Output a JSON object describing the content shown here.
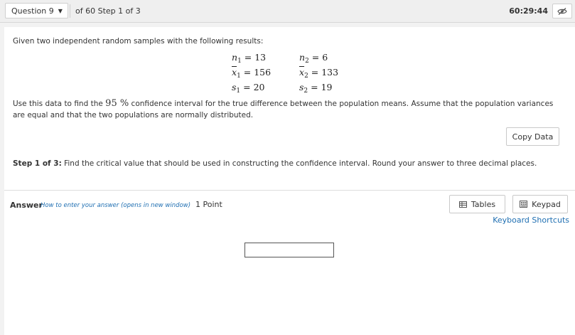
{
  "header": {
    "question_selector": "Question 9",
    "of_steps": "of 60 Step 1 of 3",
    "timer": "60:29:44",
    "visibility_icon": "eye-slash-icon"
  },
  "problem": {
    "intro": "Given two independent random samples with the following results:",
    "sample_stats": {
      "n1": "13",
      "n2": "6",
      "xbar1": "156",
      "xbar2": "133",
      "s1": "20",
      "s2": "19"
    },
    "paragraph_before": "Use this data to find the ",
    "confidence_level": "95 %",
    "paragraph_after": " confidence interval for the true difference between the population means. Assume that the population variances are equal and that the two populations are normally distributed.",
    "copy_button": "Copy Data"
  },
  "step": {
    "label": "Step 1 of 3:",
    "text": " Find the critical value that should be used in constructing the confidence interval. Round your answer to three decimal places."
  },
  "answer": {
    "label": "Answer",
    "howto_link": "How to enter your answer (opens in new window)",
    "points": "1 Point",
    "tables_button": "Tables",
    "keypad_button": "Keypad",
    "shortcuts_link": "Keyboard Shortcuts",
    "input_value": ""
  }
}
